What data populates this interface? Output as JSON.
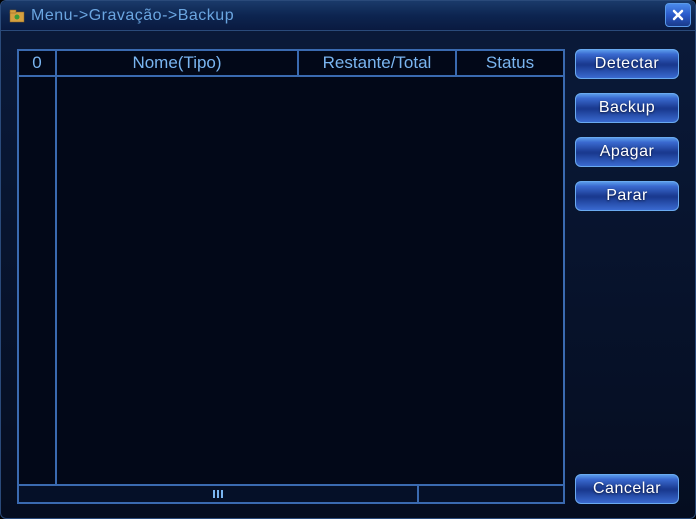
{
  "titlebar": {
    "breadcrumb": "Menu->Gravação->Backup"
  },
  "table": {
    "count": "0",
    "columns": {
      "name": "Nome(Tipo)",
      "remaining": "Restante/Total",
      "status": "Status"
    },
    "rows": []
  },
  "buttons": {
    "detect": "Detectar",
    "backup": "Backup",
    "erase": "Apagar",
    "stop": "Parar",
    "cancel": "Cancelar"
  }
}
